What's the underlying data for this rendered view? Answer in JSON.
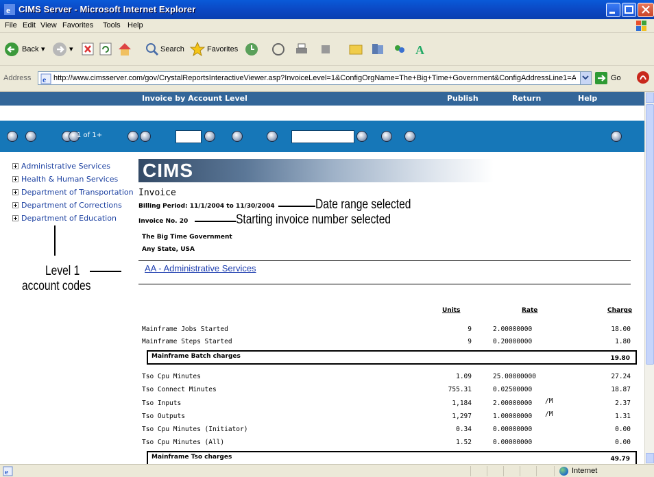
{
  "window": {
    "title": "CIMS Server - Microsoft Internet Explorer"
  },
  "menu": [
    "File",
    "Edit",
    "View",
    "Favorites",
    "Tools",
    "Help"
  ],
  "toolbar": {
    "back_label": "Back",
    "search_label": "Search",
    "favorites_label": "Favorites"
  },
  "address": {
    "label": "Address",
    "url": "http://www.cimsserver.com/gov/CrystalReportsInteractiveViewer.asp?InvoiceLevel=1&ConfigOrgName=The+Big+Time+Government&ConfigAddressLine1=Any+Stat",
    "go_label": "Go"
  },
  "report_nav": {
    "title": "Invoice by Account Level",
    "publish": "Publish",
    "return": "Return",
    "help": "Help"
  },
  "viewer_toolbar": {
    "page_indicator": "1 of 1+"
  },
  "tree": {
    "items": [
      "Administrative Services",
      "Health & Human Services",
      "Department of Transportation",
      "Department of Corrections",
      "Department of Education"
    ]
  },
  "annotations": {
    "date_range": "Date range selected",
    "invoice_number": "Starting invoice number selected",
    "level_line1": "Level 1",
    "level_line2": "account codes"
  },
  "invoice": {
    "banner": "CIMS",
    "title": "Invoice",
    "billing_period": "Billing Period: 11/1/2004 to 11/30/2004",
    "invoice_no": "Invoice No.  20",
    "org_name": "The Big Time Government",
    "org_address": "Any State, USA",
    "account_link": "AA - Administrative Services",
    "columns": {
      "units": "Units",
      "rate": "Rate",
      "charge": "Charge"
    },
    "batch_rows": [
      {
        "name": "Mainframe Jobs Started",
        "units": "9",
        "rate": "2.00000000",
        "unit_suffix": "",
        "charge": "18.00"
      },
      {
        "name": "Mainframe Steps Started",
        "units": "9",
        "rate": "0.20000000",
        "unit_suffix": "",
        "charge": "1.80"
      }
    ],
    "batch_subtotal": {
      "label": "Mainframe Batch charges",
      "value": "19.80"
    },
    "tso_rows": [
      {
        "name": "Tso Cpu Minutes",
        "units": "1.09",
        "rate": "25.00000000",
        "unit_suffix": "",
        "charge": "27.24"
      },
      {
        "name": "Tso Connect Minutes",
        "units": "755.31",
        "rate": "0.02500000",
        "unit_suffix": "",
        "charge": "18.87"
      },
      {
        "name": "Tso Inputs",
        "units": "1,184",
        "rate": "2.00000000",
        "unit_suffix": "/M",
        "charge": "2.37"
      },
      {
        "name": "Tso Outputs",
        "units": "1,297",
        "rate": "1.00000000",
        "unit_suffix": "/M",
        "charge": "1.31"
      },
      {
        "name": "Tso Cpu Minutes (Initiator)",
        "units": "0.34",
        "rate": "0.00000000",
        "unit_suffix": "",
        "charge": "0.00"
      },
      {
        "name": "Tso Cpu Minutes (All)",
        "units": "1.52",
        "rate": "0.00000000",
        "unit_suffix": "",
        "charge": "0.00"
      }
    ],
    "tso_subtotal": {
      "label": "Mainframe Tso charges",
      "value": "49.79"
    }
  },
  "status": {
    "zone": "Internet"
  }
}
